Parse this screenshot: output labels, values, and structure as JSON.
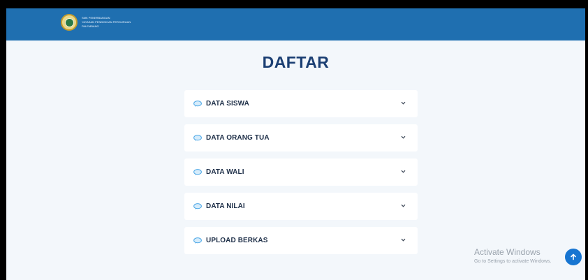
{
  "header": {
    "logo_lines": [
      "SMK PENERBANGAN",
      "YAYASAN PENDIDIKAN PERGURUAN",
      "PALEMBANG"
    ]
  },
  "page": {
    "title": "DAFTAR"
  },
  "accordion": {
    "items": [
      {
        "label": "DATA SISWA"
      },
      {
        "label": "DATA ORANG TUA"
      },
      {
        "label": "DATA WALI"
      },
      {
        "label": "DATA NILAI"
      },
      {
        "label": "UPLOAD BERKAS"
      }
    ]
  },
  "watermark": {
    "title": "Activate Windows",
    "subtitle": "Go to Settings to activate Windows."
  },
  "colors": {
    "header_bg": "#1f6fb0",
    "page_bg": "#f3f7fb",
    "title": "#1b3f73",
    "accent": "#1775d1"
  },
  "icons": {
    "item_icon": "speech-bubble-icon",
    "item_chevron": "chevron-down-icon",
    "scroll_button": "arrow-up-icon"
  }
}
